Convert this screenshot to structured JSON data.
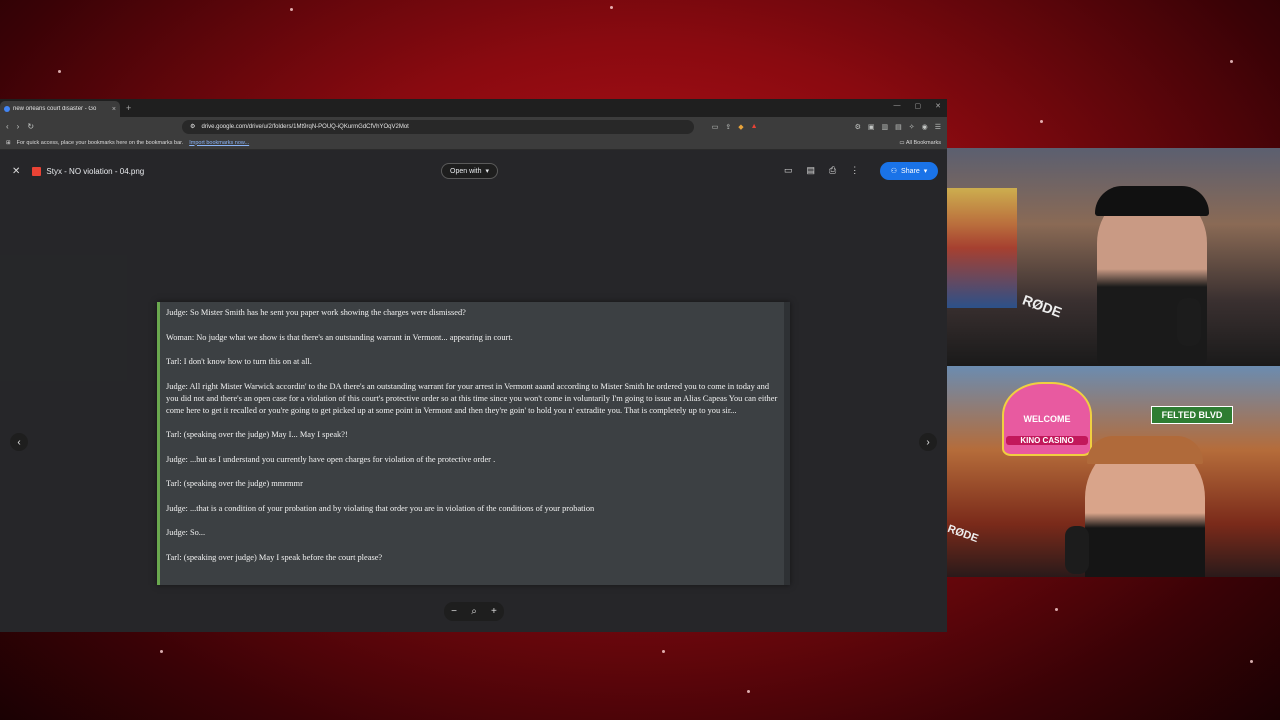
{
  "browser": {
    "tab_title": "new orleans court disaster - Go",
    "tab_close": "×",
    "new_tab": "+",
    "url": "drive.google.com/drive/u/2/folders/1Mt9rqN-POUQ-iQKurmGdCfVhYOqV2Mot",
    "bookmarks_hint": "For quick access, place your bookmarks here on the bookmarks bar.",
    "import_link": "Import bookmarks now...",
    "all_bookmarks": "All Bookmarks"
  },
  "viewer": {
    "file_name": "Styx - NO violation - 04.png",
    "open_with": "Open with",
    "share": "Share"
  },
  "document": {
    "lines": [
      "Judge: So Mister Smith has he sent you paper work showing the charges were dismissed?",
      "Woman: No judge what we show is that there's an outstanding warrant in Vermont... appearing in court.",
      "Tarl: I don't know how to turn this on at all.",
      "Judge: All right Mister Warwick accordin' to the DA there's an outstanding warrant for your arrest in Vermont aaand according to Mister Smith he ordered you to come in today and you did not and there's an open case for a violation of this court's protective order so at this time since you won't come in voluntarily I'm going to issue an Alias Capeas You can either come here to get it recalled or you're going to get picked up at some point in Vermont and then they're goin' to hold you n' extradite you. That is completely up to you sir...",
      "Tarl: (speaking over the judge) May I... May I speak?!",
      "Judge: ...but as I understand you currently have open charges for violation of the protective order .",
      "Tarl: (speaking over the judge) mmrmmr",
      "Judge: ...that is a condition of your probation and by violating that order you are in violation of the conditions of your probation",
      "Judge: So...",
      "Tarl: (speaking over judge) May I speak before the court please?"
    ]
  },
  "webcam": {
    "top_mic_brand": "RØDE",
    "bottom_sign_welcome": "WELCOME",
    "bottom_sign_casino": "KINO CASINO",
    "street_sign": "FELTED BLVD",
    "bottom_mic_brand": "RØDE"
  },
  "colors": {
    "accent_blue": "#1a73e8",
    "doc_border": "#6aa84f",
    "background_red": "#c0121a"
  }
}
